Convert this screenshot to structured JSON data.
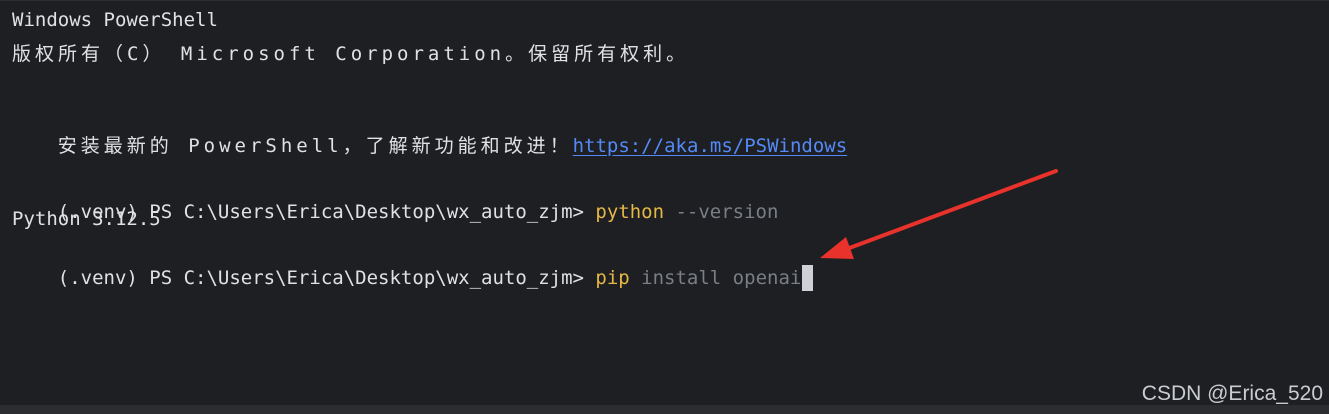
{
  "terminal": {
    "title_line": "Windows PowerShell",
    "copyright_line": "版权所有（C） Microsoft Corporation。保留所有权利。",
    "install_prompt": "安装最新的 PowerShell，了解新功能和改进！",
    "install_link": "https://aka.ms/PSWindows",
    "prompt1": "(.venv) PS C:\\Users\\Erica\\Desktop\\wx_auto_zjm> ",
    "command1_name": "python",
    "command1_args": " --version",
    "output1": "Python 3.12.5",
    "prompt2": "(.venv) PS C:\\Users\\Erica\\Desktop\\wx_auto_zjm> ",
    "command2_name": "pip",
    "command2_args": " install openai"
  },
  "watermark": "CSDN @Erica_520",
  "colors": {
    "background": "#1e1f22",
    "text": "#dfe1e5",
    "link": "#548af7",
    "command": "#e5b844",
    "argument": "#7a7e85",
    "arrow": "#e8322b"
  },
  "annotation": {
    "icon": "red-arrow-icon"
  }
}
